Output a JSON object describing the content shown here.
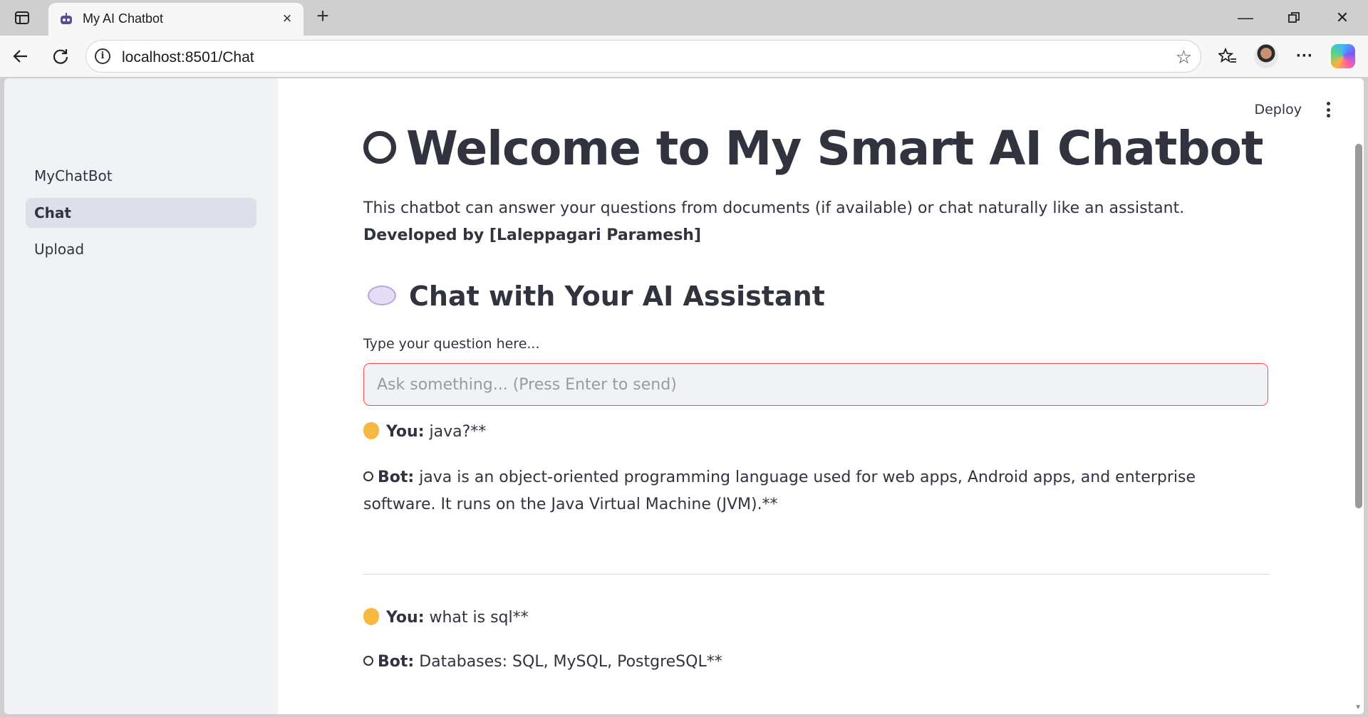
{
  "browser": {
    "tab_title": "My AI Chatbot",
    "url": "localhost:8501/Chat"
  },
  "sidebar": {
    "items": [
      {
        "label": "MyChatBot",
        "active": false
      },
      {
        "label": "Chat",
        "active": true
      },
      {
        "label": "Upload",
        "active": false
      }
    ]
  },
  "header": {
    "deploy_label": "Deploy"
  },
  "main": {
    "title": "Welcome to My Smart AI Chatbot",
    "description": "This chatbot can answer your questions from documents (if available) or chat naturally like an assistant.",
    "developer": "Developed by [Laleppagari Paramesh]",
    "section_title": "Chat with Your AI Assistant",
    "input_label": "Type your question here...",
    "input_placeholder": "Ask something... (Press Enter to send)",
    "input_value": "",
    "messages": [
      {
        "speaker": "You:",
        "text": " java?**"
      },
      {
        "speaker": "Bot:",
        "text": " java is an object-oriented programming language used for web apps, Android apps, and enterprise software. It runs on the Java Virtual Machine (JVM).**"
      },
      {
        "speaker": "You:",
        "text": " what is sql**"
      },
      {
        "speaker": "Bot:",
        "text": " Databases: SQL, MySQL, PostgreSQL**"
      }
    ]
  },
  "colors": {
    "accent": "#ff4b4b",
    "sidebar_bg": "#f0f2f6",
    "text": "#31333f"
  }
}
